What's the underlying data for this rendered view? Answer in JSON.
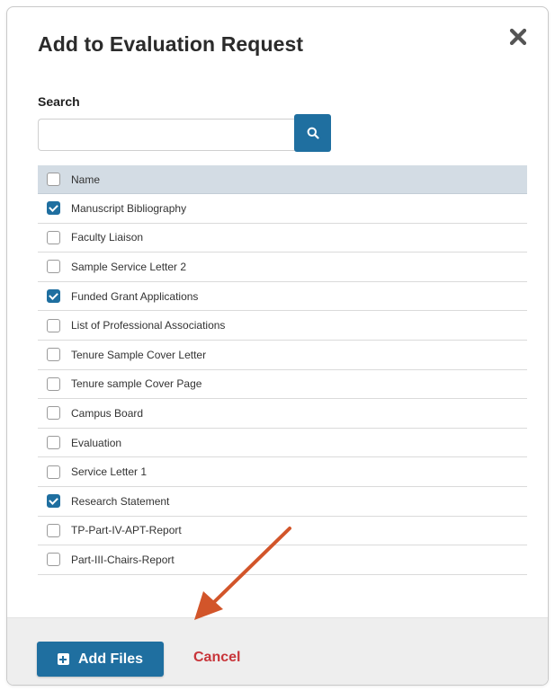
{
  "dialog": {
    "title": "Add to Evaluation Request",
    "close_icon": "close-x-icon"
  },
  "search": {
    "label": "Search",
    "value": "",
    "placeholder": "",
    "button_icon": "search-icon"
  },
  "table": {
    "header": {
      "label": "Name",
      "checked": false
    },
    "rows": [
      {
        "label": "Manuscript Bibliography",
        "checked": true
      },
      {
        "label": "Faculty Liaison",
        "checked": false
      },
      {
        "label": "Sample Service Letter 2",
        "checked": false
      },
      {
        "label": "Funded Grant Applications",
        "checked": true
      },
      {
        "label": "List of Professional Associations",
        "checked": false
      },
      {
        "label": "Tenure Sample Cover Letter",
        "checked": false
      },
      {
        "label": "Tenure sample Cover Page",
        "checked": false
      },
      {
        "label": "Campus Board",
        "checked": false
      },
      {
        "label": "Evaluation",
        "checked": false
      },
      {
        "label": "Service Letter 1",
        "checked": false
      },
      {
        "label": "Research Statement",
        "checked": true
      },
      {
        "label": "TP-Part-IV-APT-Report",
        "checked": false
      },
      {
        "label": "Part-III-Chairs-Report",
        "checked": false
      }
    ]
  },
  "footer": {
    "add_label": "Add Files",
    "add_icon": "plus-square-icon",
    "cancel_label": "Cancel"
  },
  "colors": {
    "accent": "#1f6fa0",
    "cancel": "#c8353a",
    "header_bg": "#d3dce4",
    "annotation_arrow": "#d2552a"
  }
}
